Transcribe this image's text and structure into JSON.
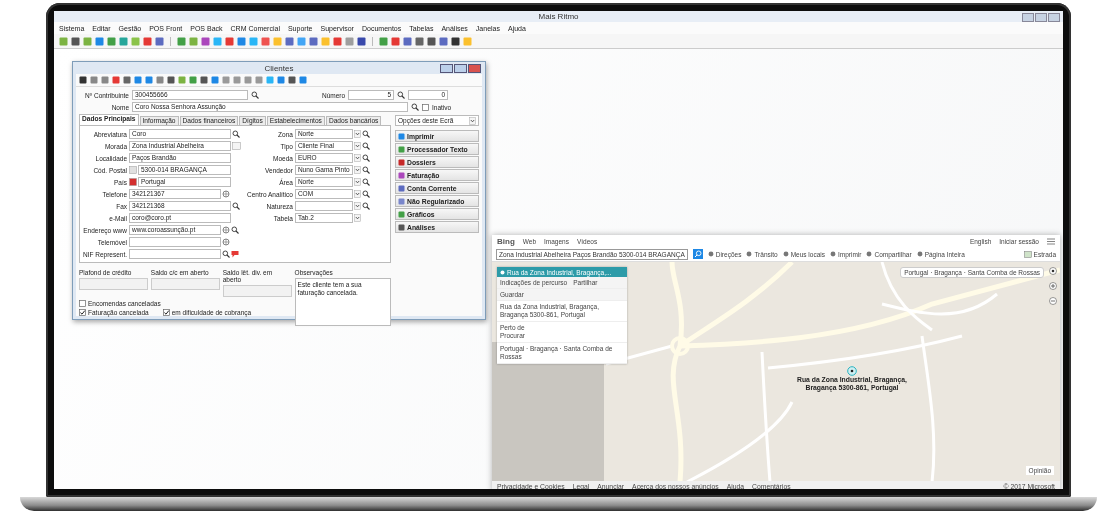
{
  "app": {
    "title": "Mais Ritmo",
    "menu": [
      "Sistema",
      "Editar",
      "Gestão",
      "POS Front",
      "POS Back",
      "CRM Comercial",
      "Suporte",
      "Supervisor",
      "Documentos",
      "Tabelas",
      "Análises",
      "Janelas",
      "Ajuda"
    ]
  },
  "clientes": {
    "title": "Clientes",
    "contribuinte": {
      "label": "Nº Contribuinte",
      "value": "300455666"
    },
    "numero": {
      "label": "Número",
      "value": "5",
      "extra": "0"
    },
    "nome": {
      "label": "Nome",
      "value": "Coro Nossa Senhora Assunção"
    },
    "inativo": {
      "label": "Inativo",
      "checked": false
    },
    "tabs": [
      {
        "label": "Dados Principais",
        "selected": true
      },
      {
        "label": "Informação",
        "selected": false
      },
      {
        "label": "Dados financeiros",
        "selected": false
      },
      {
        "label": "Dígitos",
        "selected": false
      },
      {
        "label": "Estabelecimentos",
        "selected": false
      },
      {
        "label": "Dados bancários",
        "selected": false
      }
    ],
    "left_fields": [
      {
        "label": "Abreviatura",
        "value": "Coro",
        "kind": "search"
      },
      {
        "label": "Morada",
        "value": "Zona Industrial Abelheira",
        "kind": "note"
      },
      {
        "label": "Localidade",
        "value": "Paços Brandão",
        "kind": "plain"
      },
      {
        "label": "Cód. Postal",
        "value": "5300-014 BRAGANÇA",
        "kind": "prefix"
      },
      {
        "label": "País",
        "value": "Portugal",
        "kind": "flag"
      },
      {
        "label": "Telefone",
        "value": "342121367",
        "kind": "dial"
      },
      {
        "label": "Fax",
        "value": "342121368",
        "kind": "search"
      },
      {
        "label": "e-Mail",
        "value": "coro@coro.pt",
        "kind": "plain"
      },
      {
        "label": "Endereço www",
        "value": "www.coroassunção.pt",
        "kind": "web"
      },
      {
        "label": "Telemóvel",
        "kind": "dial"
      },
      {
        "label": "NIF Represent.",
        "kind": "nif"
      }
    ],
    "right_fields": [
      {
        "label": "Zona",
        "value": "Norte",
        "kind": "dropsearch"
      },
      {
        "label": "Tipo",
        "value": "Cliente Final",
        "kind": "dropsearch"
      },
      {
        "label": "Moeda",
        "value": "EURO",
        "kind": "dropsearch"
      },
      {
        "label": "Vendedor",
        "value": "Nuno Gama Pinto",
        "kind": "dropsearch"
      },
      {
        "label": "Área",
        "value": "Norte",
        "kind": "dropsearch"
      },
      {
        "label": "Centro Analítico",
        "value": "COM",
        "kind": "dropsearch"
      },
      {
        "label": "Natureza",
        "kind": "dropsearch"
      },
      {
        "label": "Tabela",
        "value": "Tab.2",
        "kind": "dropdown"
      }
    ],
    "balances": [
      "Plafond de crédito",
      "Saldo c/c em aberto",
      "Saldo lêt. div. em aberto"
    ],
    "observacoes": {
      "label": "Observações",
      "text": "Este cliente tem a sua faturação cancelada."
    },
    "checks": [
      {
        "label": "Encomendas canceladas",
        "checked": false
      },
      {
        "label": "Faturação cancelada",
        "checked": true
      },
      {
        "label": "em dificuldade de cobrança",
        "checked": true
      }
    ],
    "options": {
      "title": "Opções deste Ecrã",
      "items": [
        "Imprimir",
        "Processador Texto",
        "Dossiers",
        "Faturação",
        "Conta Corrente",
        "Não Regularizado",
        "Gráficos",
        "Análises"
      ]
    }
  },
  "map": {
    "logo": "Bing",
    "nav": [
      "Web",
      "Imagens",
      "Vídeos"
    ],
    "account": [
      "English",
      "Iniciar sessão"
    ],
    "search": {
      "value": "Zona Industrial Abelheira Paços Brandão 5300-014 BRAGANÇA"
    },
    "tools": [
      "Direções",
      "Trânsito",
      "Meus locais",
      "Imprimir",
      "Compartilhar",
      "Página Inteira"
    ],
    "style": "Estrada",
    "panel": {
      "title": "Rua da Zona Industrial, Bragança,...",
      "actions": [
        "Indicações de percurso",
        "Partilhar"
      ],
      "save": "Guardar",
      "address": "Rua da Zona Industrial, Bragança, Bragança 5300-861, Portugal",
      "near_label": "Perto de",
      "near_search": "Procurar",
      "breadcrumb": "Portugal · Bragança · Santa Comba de Rossas"
    },
    "breadcrumb": "Portugal · Bragança · Santa Comba de Rossas",
    "pin_label": "Rua da Zona Industrial, Bragança, Bragança 5300-861, Portugal",
    "feedback": "Opinião",
    "footer": [
      "Privacidade e Cookies",
      "Legal",
      "Anunciar",
      "Acerca dos nossos anúncios",
      "Ajuda",
      "Comentários"
    ],
    "copyright": "© 2017 Microsoft"
  }
}
